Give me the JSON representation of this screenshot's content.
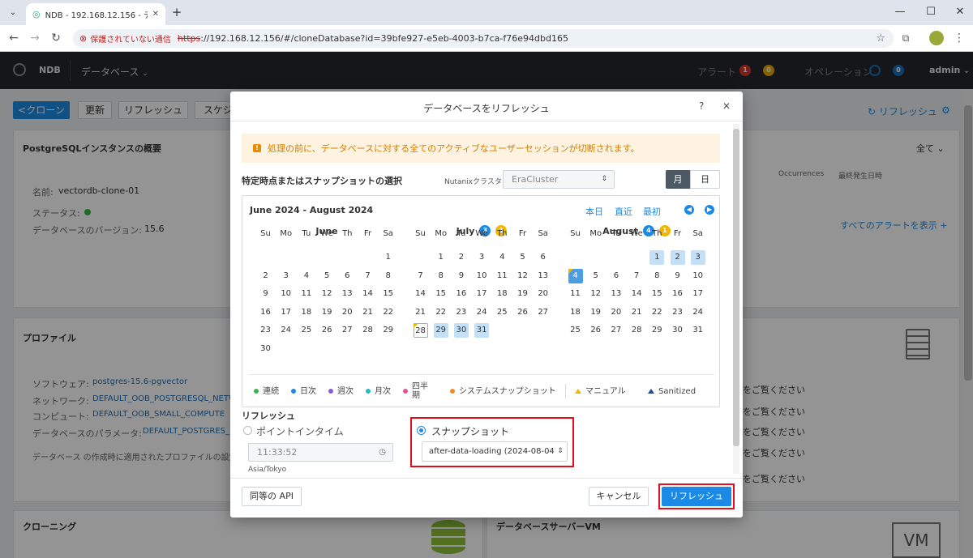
{
  "browser": {
    "tab_title": "NDB - 192.168.12.156 - データベ",
    "not_secure": "保護されていない通信",
    "url_scheme": "https",
    "url_rest": "://192.168.12.156/#/cloneDatabase?id=39bfe927-e5eb-4003-b7ca-f76e94dbd165"
  },
  "app_header": {
    "product": "NDB",
    "menu": "データベース",
    "alerts_label": "アラート",
    "alerts_red": "1",
    "alerts_yellow": "0",
    "ops_label": "オペレーション",
    "ops_count": "0",
    "user": "admin"
  },
  "page": {
    "clone_btn": "<クローン",
    "update_btn": "更新",
    "refresh_btn": "リフレッシュ",
    "schedule_btn": "スケジ",
    "refresh_link": "リフレッシュ",
    "overview_title": "PostgreSQLインスタンスの概要",
    "name_label": "名前:",
    "name_value": "vectordb-clone-01",
    "status_label": "ステータス:",
    "version_label": "データベースのバージョン:",
    "version_value": "15.6",
    "all_label": "全て",
    "occurrences": "Occurrences",
    "last_date": "最終発生日時",
    "show_all_alerts": "すべてのアラートを表示",
    "profile_title": "プロファイル",
    "software_label": "ソフトウェア:",
    "software_value": "postgres-15.6-pgvector",
    "network_label": "ネットワーク:",
    "network_value": "DEFAULT_OOB_POSTGRESQL_NETW",
    "compute_label": "コンピュート:",
    "compute_value": "DEFAULT_OOB_SMALL_COMPUTE",
    "params_label": "データベースのパラメータ:",
    "params_value": "DEFAULT_POSTGRES_",
    "profile_note": "データベース の作成時に適用されたプロファイルの設定が、",
    "right_note": "をご覧ください",
    "cloning_title": "クローニング",
    "dbserver_title": "データベースサーバーVM",
    "vm_label": "VM"
  },
  "modal": {
    "title": "データベースをリフレッシュ",
    "help": "?",
    "close": "✕",
    "warning": "処理の前に、データベースに対する全てのアクティブなユーザーセッションが切断されます。",
    "select_label": "特定時点またはスナップショットの選択",
    "cluster_label": "Nutanixクラスタ",
    "cluster_value": "EraCluster",
    "view_month": "月",
    "view_day": "日",
    "calendar": {
      "range": "June 2024 - August 2024",
      "today": "本日",
      "recent": "直近",
      "first": "最初",
      "weekdays": [
        "Su",
        "Mo",
        "Tu",
        "We",
        "Th",
        "Fr",
        "Sa"
      ],
      "months": [
        {
          "name": "June",
          "badge_blue": "",
          "badge_yellow": "",
          "start": 6,
          "days": 30,
          "snap": [],
          "sel": [],
          "today": []
        },
        {
          "name": "July",
          "badge_blue": "3",
          "badge_yellow": "1",
          "start": 1,
          "days": 31,
          "snap": [
            29,
            30,
            31
          ],
          "sel": [],
          "today": [
            28
          ]
        },
        {
          "name": "August",
          "badge_blue": "4",
          "badge_yellow": "1",
          "start": 4,
          "days": 31,
          "snap": [
            1,
            2,
            3
          ],
          "sel": [
            4
          ],
          "today": []
        }
      ]
    },
    "legend": [
      {
        "label": "連続",
        "color": "#3bb54a"
      },
      {
        "label": "日次",
        "color": "#1b8ae6"
      },
      {
        "label": "週次",
        "color": "#8a5bd6"
      },
      {
        "label": "月次",
        "color": "#26b8c9"
      },
      {
        "label": "四半期",
        "color": "#e8509c"
      },
      {
        "label": "システムスナップショット",
        "color": "#f08a24"
      },
      {
        "label": "マニュアル",
        "color": "#f2b600"
      },
      {
        "label": "Sanitized",
        "color": "#1d4a9e"
      }
    ],
    "refresh_section": "リフレッシュ",
    "pit_label": "ポイントインタイム",
    "pit_time": "11:33:52",
    "timezone": "Asia/Tokyo",
    "snapshot_label": "スナップショット",
    "snapshot_value": "after-data-loading (2024-08-04 2:",
    "api_btn": "同等の API",
    "cancel_btn": "キャンセル",
    "submit_btn": "リフレッシュ"
  }
}
